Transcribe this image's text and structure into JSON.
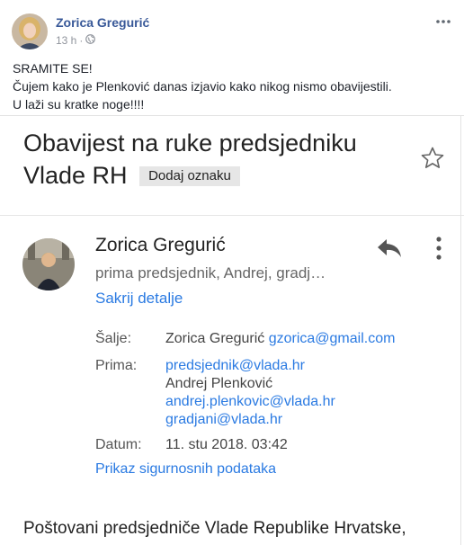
{
  "post": {
    "author": "Zorica Gregurić",
    "time": "13 h",
    "separator": "·",
    "privacy_icon": "globe-icon",
    "lines": [
      "SRAMITE SE!",
      "Čujem kako je Plenković danas izjavio kako nikog nismo obavijestili.",
      "U laži su kratke noge!!!!"
    ]
  },
  "email": {
    "subject": "Obavijest na ruke predsjedniku Vlade RH",
    "add_label": "Dodaj oznaku",
    "sender_name": "Zorica Gregurić",
    "recipients_summary": "prima predsjednik, Andrej, gradj…",
    "hide_details": "Sakrij detalje",
    "details": {
      "from_label": "Šalje:",
      "from_name": "Zorica Gregurić",
      "from_email": "gzorica@gmail.com",
      "to_label": "Prima:",
      "to_lines": [
        "predsjednik@vlada.hr",
        "Andrej Plenković",
        "andrej.plenkovic@vlada.hr",
        "gradjani@vlada.hr"
      ],
      "date_label": "Datum:",
      "date_value": "11. stu 2018. 03:42"
    },
    "security_link": "Prikaz sigurnosnih podataka",
    "greeting": "Poštovani predsjedniče Vlade Republike Hrvatske,"
  },
  "colors": {
    "fb_link": "#385898",
    "gmail_link": "#2a7ae2"
  }
}
